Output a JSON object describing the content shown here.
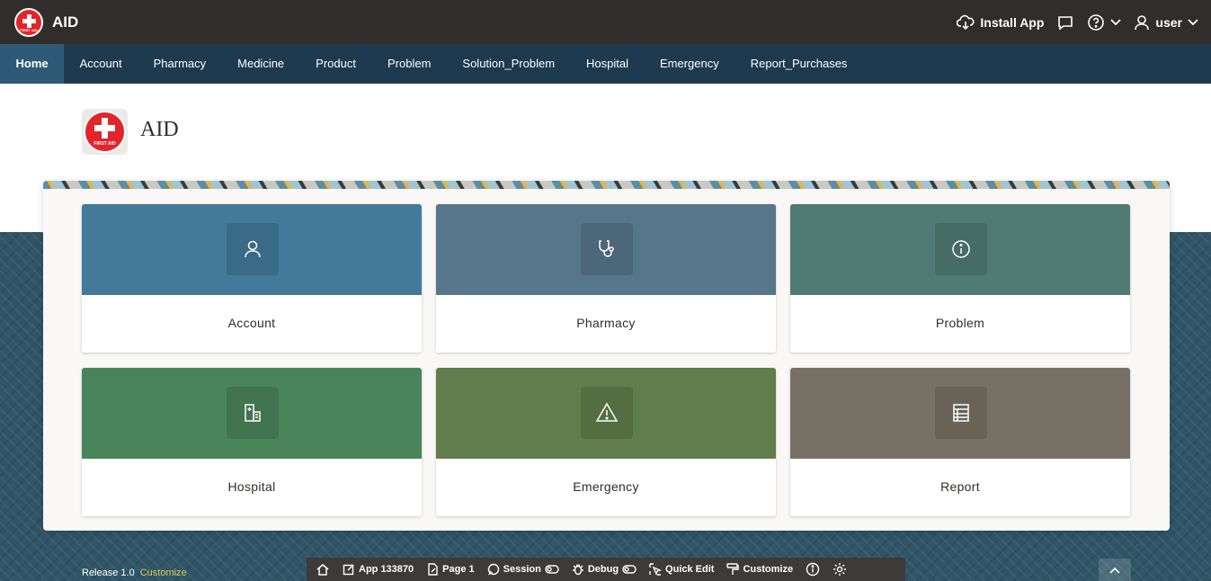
{
  "header": {
    "app_title": "AID",
    "logo_text": "FIRST AID",
    "install_label": "Install App",
    "user_label": "user"
  },
  "nav": {
    "items": [
      {
        "label": "Home",
        "active": true
      },
      {
        "label": "Account"
      },
      {
        "label": "Pharmacy"
      },
      {
        "label": "Medicine"
      },
      {
        "label": "Product"
      },
      {
        "label": "Problem"
      },
      {
        "label": "Solution_Problem"
      },
      {
        "label": "Hospital"
      },
      {
        "label": "Emergency"
      },
      {
        "label": "Report_Purchases"
      }
    ]
  },
  "page": {
    "title": "AID",
    "logo_text": "FIRST AID"
  },
  "cards": [
    {
      "label": "Account",
      "color": "#437a99",
      "icon": "user-icon"
    },
    {
      "label": "Pharmacy",
      "color": "#56768a",
      "icon": "stethoscope-icon"
    },
    {
      "label": "Problem",
      "color": "#4f7b74",
      "icon": "info-icon"
    },
    {
      "label": "Hospital",
      "color": "#4a845b",
      "icon": "hospital-icon"
    },
    {
      "label": "Emergency",
      "color": "#607d4b",
      "icon": "warning-icon"
    },
    {
      "label": "Report",
      "color": "#777064",
      "icon": "report-icon"
    }
  ],
  "footer": {
    "release": "Release 1.0",
    "customize": "Customize"
  },
  "devbar": {
    "app": "App 133870",
    "page": "Page 1",
    "session": "Session",
    "debug": "Debug",
    "quick_edit": "Quick Edit",
    "customize": "Customize"
  }
}
